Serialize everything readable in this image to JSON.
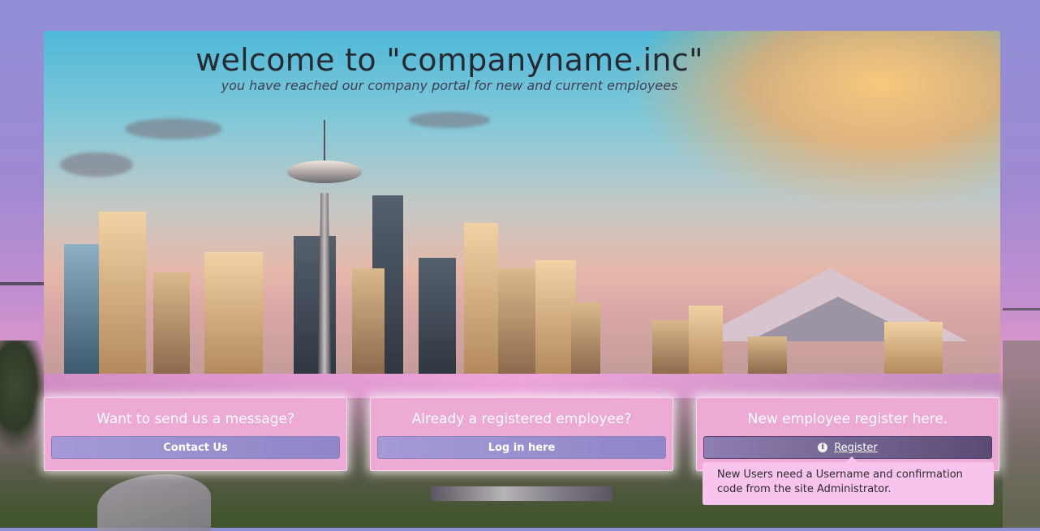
{
  "hero": {
    "title": "welcome to \"companyname.inc\"",
    "subtitle": "you have reached our company portal for new and current employees"
  },
  "cards": [
    {
      "title": "Want to send us a message?",
      "button_label": "Contact Us"
    },
    {
      "title": "Already a registered employee?",
      "button_label": "Log in here"
    },
    {
      "title": "New employee register here.",
      "button_label": "Register",
      "button_icon": "info-icon"
    }
  ],
  "tooltip": {
    "text": "New Users need a Username and confirmation code from the site Administrator."
  },
  "colors": {
    "card_background": "#ecaad4",
    "button_background": "#a59ad6",
    "register_button_background": "#5b4a74",
    "tooltip_background": "#f8c3ec",
    "title_text": "#252a33"
  }
}
